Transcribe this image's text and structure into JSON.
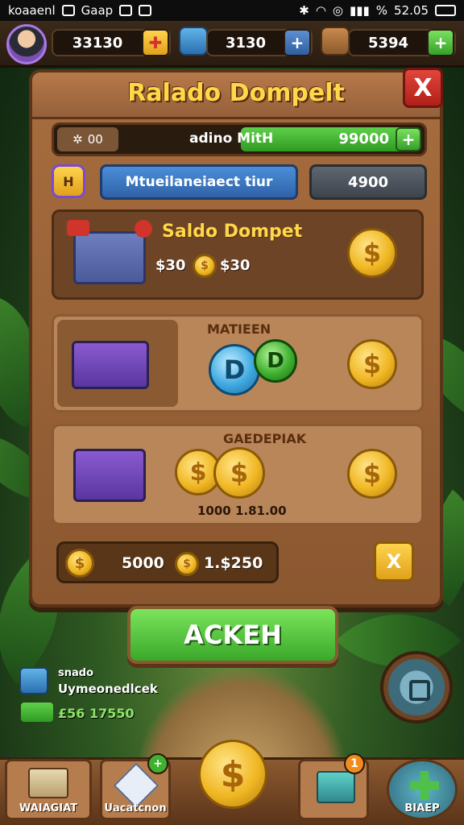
{
  "status_bar": {
    "left_text": "koaaenl",
    "app_label": "Gaap",
    "time": "52.05",
    "battery_text": "%"
  },
  "resources": {
    "gold": "33130",
    "gems": "3130",
    "wood": "5394"
  },
  "panel": {
    "title": "Ralado Dompelt",
    "close_icon": "X"
  },
  "progress": {
    "left_value": "00",
    "label": "adino MitH",
    "value": "99000",
    "plus": "+"
  },
  "row2": {
    "small_btn": "H",
    "name_field": "Mtueilaneiaect tiur",
    "gray_field": "4900"
  },
  "cards": [
    {
      "title": "Saldo Dompet",
      "price_a": "$30",
      "price_b": "$30"
    },
    {
      "title": "MATIEEN"
    },
    {
      "title": "GAEDEPIAK",
      "caption": "1000 1.81.00"
    }
  ],
  "total": {
    "value_a": "5000",
    "value_b": "1.$250",
    "x_label": "X"
  },
  "main_button": {
    "label": "ACKEH"
  },
  "notice": {
    "line1": "snado",
    "line2": "Uymeonedlcek",
    "line3": "£56 17550"
  },
  "bottom_nav": [
    {
      "label": "WAIAGIAT"
    },
    {
      "label": "Uacatcnon",
      "badge": "+"
    },
    {
      "label": ""
    },
    {
      "label": "",
      "badge": "1"
    },
    {
      "label": "BIAEP"
    }
  ],
  "colors": {
    "accent_gold": "#ffd84a",
    "button_green": "#4cc23a",
    "close_red": "#d0342a",
    "panel_brown": "#9a623a"
  }
}
